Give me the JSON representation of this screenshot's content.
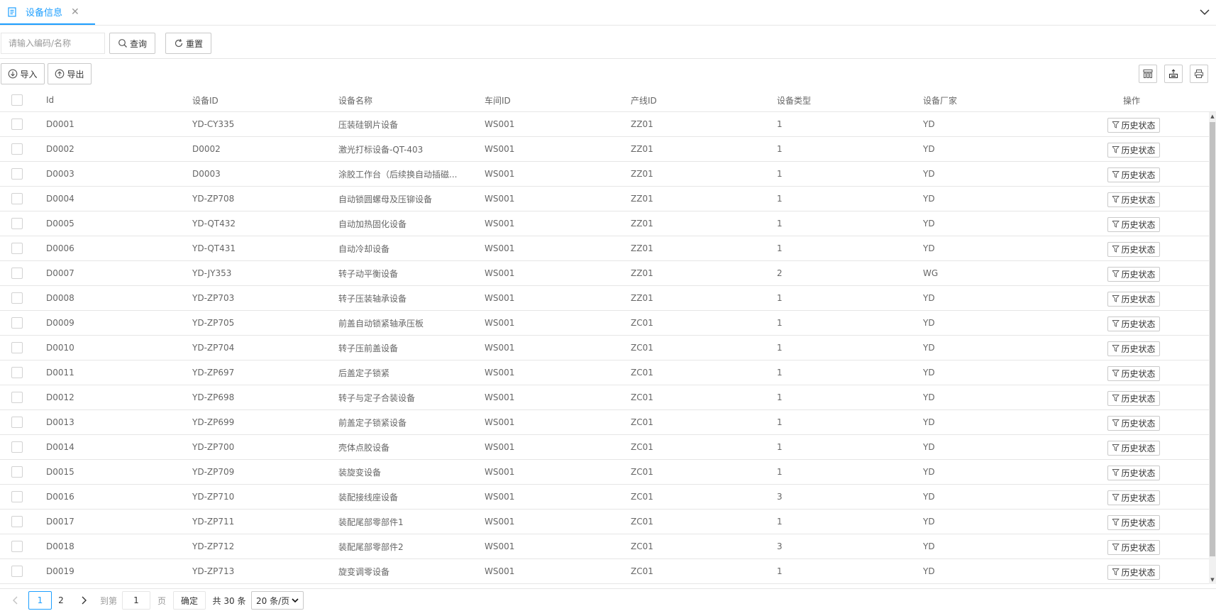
{
  "tab": {
    "label": "设备信息",
    "close_symbol": "✕",
    "icon": "document-icon"
  },
  "search": {
    "placeholder": "请输入编码/名称",
    "value": "",
    "query_label": "查询",
    "reset_label": "重置"
  },
  "toolbar": {
    "import_label": "导入",
    "export_label": "导出",
    "right_icons": [
      "columns-icon",
      "export-icon",
      "print-icon"
    ]
  },
  "table": {
    "headers": {
      "id": "Id",
      "device_id": "设备ID",
      "name": "设备名称",
      "workshop": "车间ID",
      "line": "产线ID",
      "type": "设备类型",
      "vendor": "设备厂家",
      "op": "操作"
    },
    "rows": [
      {
        "id": "D0001",
        "device_id": "YD-CY335",
        "name": "压装硅钢片设备",
        "workshop": "WS001",
        "line": "ZZ01",
        "type": "1",
        "vendor": "YD",
        "op": "历史状态"
      },
      {
        "id": "D0002",
        "device_id": "D0002",
        "name": "激光打标设备-QT-403",
        "workshop": "WS001",
        "line": "ZZ01",
        "type": "1",
        "vendor": "YD",
        "op": "历史状态"
      },
      {
        "id": "D0003",
        "device_id": "D0003",
        "name": "涂胶工作台（后续换自动插磁...",
        "workshop": "WS001",
        "line": "ZZ01",
        "type": "1",
        "vendor": "YD",
        "op": "历史状态"
      },
      {
        "id": "D0004",
        "device_id": "YD-ZP708",
        "name": "自动锁圆螺母及压铆设备",
        "workshop": "WS001",
        "line": "ZZ01",
        "type": "1",
        "vendor": "YD",
        "op": "历史状态"
      },
      {
        "id": "D0005",
        "device_id": "YD-QT432",
        "name": "自动加热固化设备",
        "workshop": "WS001",
        "line": "ZZ01",
        "type": "1",
        "vendor": "YD",
        "op": "历史状态"
      },
      {
        "id": "D0006",
        "device_id": "YD-QT431",
        "name": "自动冷却设备",
        "workshop": "WS001",
        "line": "ZZ01",
        "type": "1",
        "vendor": "YD",
        "op": "历史状态"
      },
      {
        "id": "D0007",
        "device_id": "YD-JY353",
        "name": "转子动平衡设备",
        "workshop": "WS001",
        "line": "ZZ01",
        "type": "2",
        "vendor": "WG",
        "op": "历史状态"
      },
      {
        "id": "D0008",
        "device_id": "YD-ZP703",
        "name": "转子压装轴承设备",
        "workshop": "WS001",
        "line": "ZZ01",
        "type": "1",
        "vendor": "YD",
        "op": "历史状态"
      },
      {
        "id": "D0009",
        "device_id": "YD-ZP705",
        "name": "前盖自动锁紧轴承压板",
        "workshop": "WS001",
        "line": "ZC01",
        "type": "1",
        "vendor": "YD",
        "op": "历史状态"
      },
      {
        "id": "D0010",
        "device_id": "YD-ZP704",
        "name": "转子压前盖设备",
        "workshop": "WS001",
        "line": "ZC01",
        "type": "1",
        "vendor": "YD",
        "op": "历史状态"
      },
      {
        "id": "D0011",
        "device_id": "YD-ZP697",
        "name": "后盖定子锁紧",
        "workshop": "WS001",
        "line": "ZC01",
        "type": "1",
        "vendor": "YD",
        "op": "历史状态"
      },
      {
        "id": "D0012",
        "device_id": "YD-ZP698",
        "name": "转子与定子合装设备",
        "workshop": "WS001",
        "line": "ZC01",
        "type": "1",
        "vendor": "YD",
        "op": "历史状态"
      },
      {
        "id": "D0013",
        "device_id": "YD-ZP699",
        "name": "前盖定子锁紧设备",
        "workshop": "WS001",
        "line": "ZC01",
        "type": "1",
        "vendor": "YD",
        "op": "历史状态"
      },
      {
        "id": "D0014",
        "device_id": "YD-ZP700",
        "name": "壳体点胶设备",
        "workshop": "WS001",
        "line": "ZC01",
        "type": "1",
        "vendor": "YD",
        "op": "历史状态"
      },
      {
        "id": "D0015",
        "device_id": "YD-ZP709",
        "name": "装旋变设备",
        "workshop": "WS001",
        "line": "ZC01",
        "type": "1",
        "vendor": "YD",
        "op": "历史状态"
      },
      {
        "id": "D0016",
        "device_id": "YD-ZP710",
        "name": "装配接线座设备",
        "workshop": "WS001",
        "line": "ZC01",
        "type": "3",
        "vendor": "YD",
        "op": "历史状态"
      },
      {
        "id": "D0017",
        "device_id": "YD-ZP711",
        "name": "装配尾部零部件1",
        "workshop": "WS001",
        "line": "ZC01",
        "type": "1",
        "vendor": "YD",
        "op": "历史状态"
      },
      {
        "id": "D0018",
        "device_id": "YD-ZP712",
        "name": "装配尾部零部件2",
        "workshop": "WS001",
        "line": "ZC01",
        "type": "3",
        "vendor": "YD",
        "op": "历史状态"
      },
      {
        "id": "D0019",
        "device_id": "YD-ZP713",
        "name": "旋变调零设备",
        "workshop": "WS001",
        "line": "ZC01",
        "type": "1",
        "vendor": "YD",
        "op": "历史状态"
      }
    ]
  },
  "pagination": {
    "pages": [
      "1",
      "2"
    ],
    "current": "1",
    "goto_label": "到第",
    "goto_value": "1",
    "page_unit": "页",
    "confirm_label": "确定",
    "total_label": "共 30 条",
    "page_size": "20 条/页"
  },
  "colors": {
    "accent": "#1e9fff",
    "border": "#e6e6e6",
    "text": "#666666"
  }
}
